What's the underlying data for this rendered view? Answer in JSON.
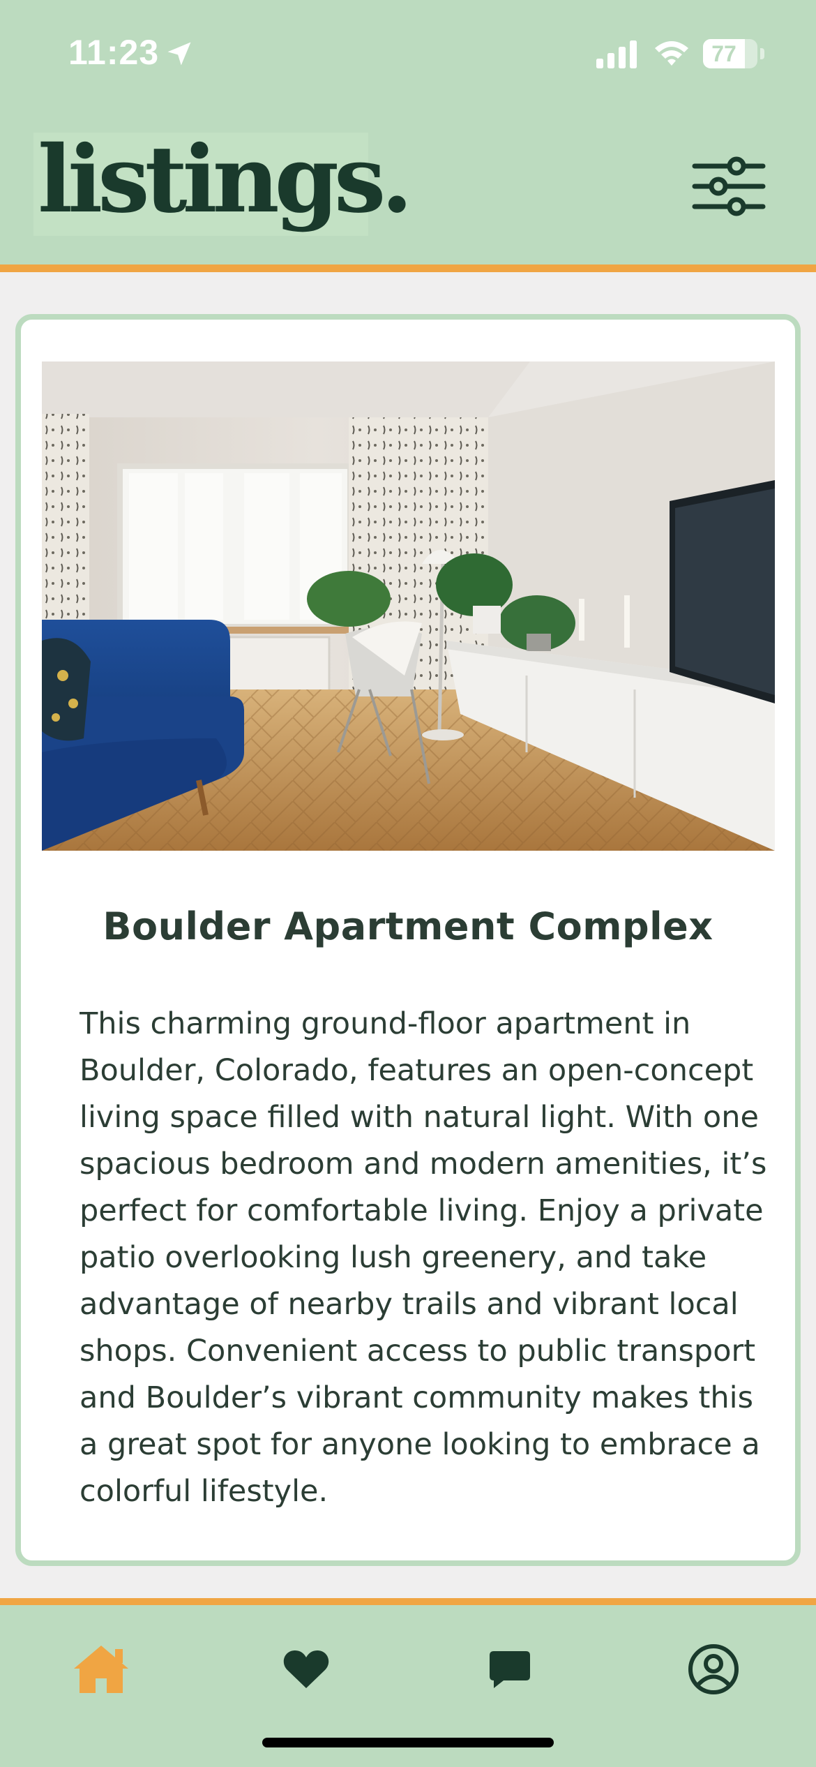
{
  "status_bar": {
    "time": "11:23",
    "battery_percent": 77,
    "battery_label": "77",
    "icons": [
      "location-arrow-icon",
      "cellular-signal-icon",
      "wifi-icon",
      "battery-icon"
    ]
  },
  "header": {
    "logo": "listings.",
    "filter_icon": "sliders-icon"
  },
  "listing": {
    "photo_description_icon": "living-room-photo",
    "title": "Boulder Apartment Complex",
    "description": "This charming ground-floor apartment in Boulder, Colorado, features an open-concept living space filled with natural light. With one spacious bedroom and modern amenities, it’s perfect for comfortable living. Enjoy a private patio overlooking lush greenery, and take advantage of nearby trails and vibrant local shops. Convenient access to public transport and Boulder’s vibrant community makes this a great spot for anyone looking to embrace a colorful lifestyle."
  },
  "tab_bar": {
    "tabs": [
      {
        "id": "home",
        "icon": "home-icon",
        "active": true
      },
      {
        "id": "favorites",
        "icon": "heart-icon",
        "active": false
      },
      {
        "id": "messages",
        "icon": "chat-bubble-icon",
        "active": false
      },
      {
        "id": "profile",
        "icon": "user-circle-icon",
        "active": false
      }
    ]
  },
  "colors": {
    "header_bg": "#bcdbbf",
    "accent_orange": "#f0a543",
    "dark_green": "#1a3a2c",
    "page_bg": "#f0efef",
    "card_bg": "#ffffff"
  }
}
